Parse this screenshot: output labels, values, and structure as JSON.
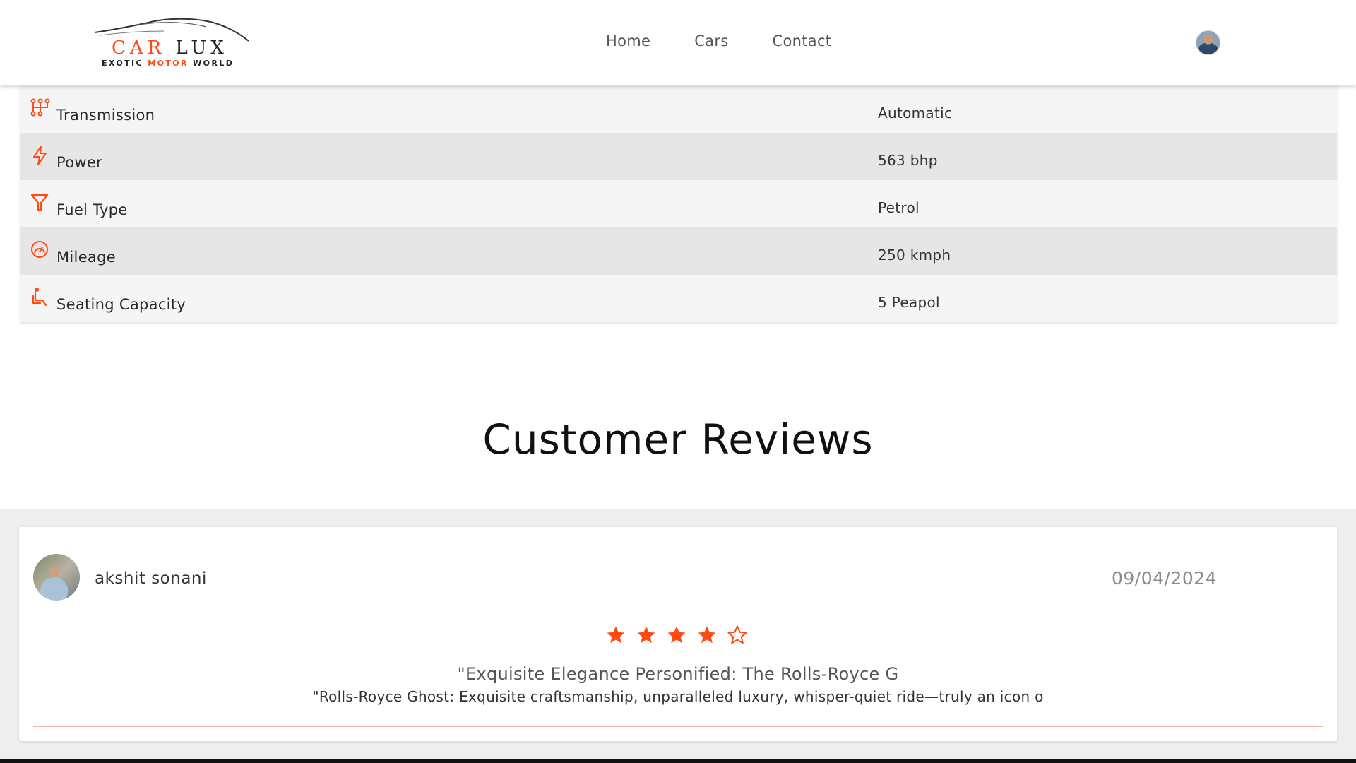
{
  "header": {
    "logo": {
      "main_left": "CAR",
      "main_right": "LUX",
      "sub_left": "EXOTIC",
      "sub_accent": "MOTOR",
      "sub_right": "WORLD",
      "icon": "car-silhouette-logo"
    },
    "nav": [
      {
        "label": "Home"
      },
      {
        "label": "Cars"
      },
      {
        "label": "Contact"
      }
    ],
    "profile_icon": "user-avatar"
  },
  "specs": [
    {
      "icon": "transmission-icon",
      "label": "Transmission",
      "value": "Automatic"
    },
    {
      "icon": "lightning-icon",
      "label": "Power",
      "value": "563 bhp"
    },
    {
      "icon": "funnel-icon",
      "label": "Fuel Type",
      "value": "Petrol"
    },
    {
      "icon": "speedometer-icon",
      "label": "Mileage",
      "value": "250 kmph"
    },
    {
      "icon": "seat-icon",
      "label": "Seating Capacity",
      "value": "5 Peapol"
    }
  ],
  "reviews": {
    "title": "Customer Reviews",
    "items": [
      {
        "name": "akshit sonani",
        "date": "09/04/2024",
        "rating": 4,
        "max_rating": 5,
        "headline": "\"Exquisite Elegance Personified: The Rolls-Royce G",
        "body": "\"Rolls-Royce Ghost: Exquisite craftsmanship, unparalleled luxury, whisper-quiet ride—truly an icon o"
      }
    ]
  },
  "colors": {
    "accent": "#ff4a14",
    "row_light": "#f5f5f5",
    "row_dark": "#e6e6e6",
    "panel_bg": "#eeeeee",
    "divider": "#f0b7a3"
  }
}
